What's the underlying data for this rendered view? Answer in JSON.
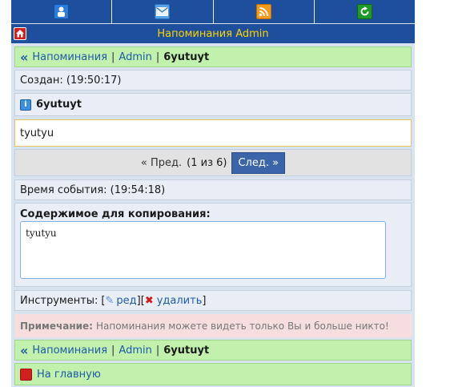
{
  "header": {
    "title": "Напоминания Admin"
  },
  "breadcrumb_top": {
    "root": "Напоминания",
    "user": "Admin",
    "current": "6yutuyt"
  },
  "created": "Создан: (19:50:17)",
  "item": {
    "title": "6yutuyt",
    "body": "tyutyu"
  },
  "pagination": {
    "prev_label": "« Пред.",
    "status": "(1 из 6)",
    "next_label": "След. »"
  },
  "event_time": "Время события: (19:54:18)",
  "copy": {
    "label": "Содержимое для копирования:",
    "value": "tyutyu"
  },
  "tools": {
    "label": "Инструменты:",
    "edit_label": "ред",
    "delete_label": "удалить"
  },
  "note": {
    "label": "Примечание:",
    "text": "Напоминания можете видеть только Вы и больше никто!"
  },
  "breadcrumb_bottom": {
    "root": "Напоминания",
    "user": "Admin",
    "current": "6yutuyt"
  },
  "home_link": "На главную",
  "colors": {
    "header_bg": "#1e4f9c",
    "title_text": "#ffd200",
    "green_row": "#c2f0ad",
    "link": "#1e5aa8",
    "note_bg": "#f6dede"
  },
  "icons": [
    "user-icon",
    "mail-icon",
    "rss-icon",
    "refresh-icon",
    "home-icon",
    "info-icon",
    "pencil-icon",
    "delete-icon"
  ]
}
